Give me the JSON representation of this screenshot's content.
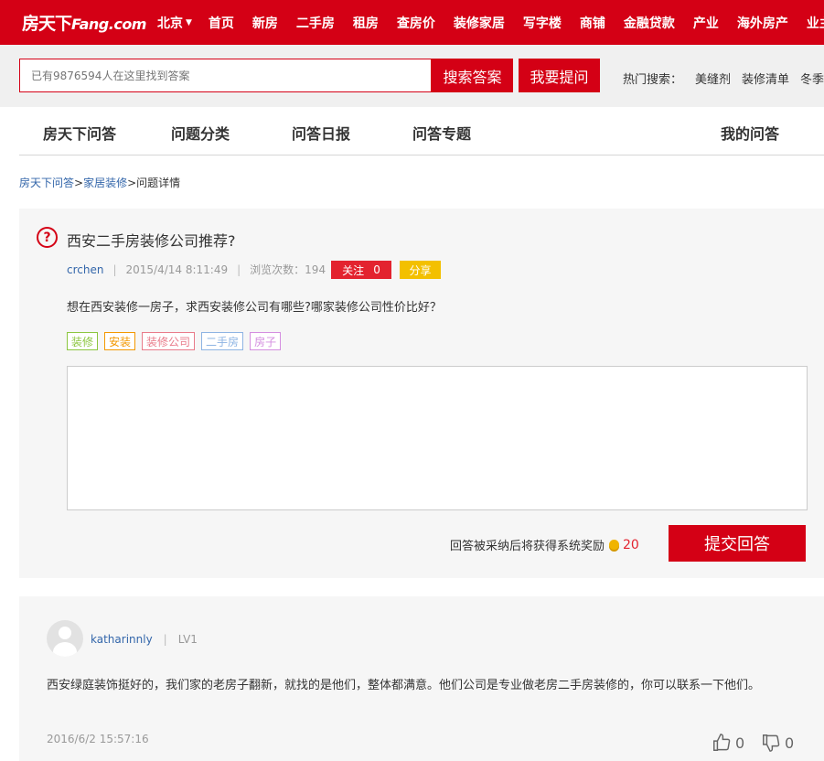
{
  "topnav": {
    "logo_cn": "房天下",
    "logo_en": "Fang.com",
    "city": "北京",
    "links": [
      "首页",
      "新房",
      "二手房",
      "租房",
      "查房价",
      "装修家居",
      "写字楼",
      "商铺",
      "金融贷款",
      "产业",
      "海外房产",
      "业主论"
    ]
  },
  "search": {
    "placeholder": "已有9876594人在这里找到答案",
    "search_button": "搜索答案",
    "ask_button": "我要提问",
    "hot_label": "热门搜索：",
    "hot_terms": [
      "美缝剂",
      "装修清单",
      "冬季"
    ]
  },
  "subnav": {
    "items": [
      "房天下问答",
      "问题分类",
      "问答日报",
      "问答专题"
    ],
    "my_answers": "我的问答"
  },
  "breadcrumb": {
    "items": [
      "房天下问答",
      "家居装修",
      "问题详情"
    ],
    "sep": ">"
  },
  "question": {
    "title": "西安二手房装修公司推荐?",
    "user": "crchen",
    "datetime": "2015/4/14 8:11:49",
    "views_label": "浏览次数：194",
    "follow_label": "关注",
    "follow_count": "0",
    "share_label": "分享",
    "body": "想在西安装修一房子，求西安装修公司有哪些?哪家装修公司性价比好？",
    "tags": [
      {
        "label": "装修",
        "color": "#8cc63f"
      },
      {
        "label": "安装",
        "color": "#f39800"
      },
      {
        "label": "装修公司",
        "color": "#e97b8a"
      },
      {
        "label": "二手房",
        "color": "#8eb4e3"
      },
      {
        "label": "房子",
        "color": "#d48ee0"
      }
    ],
    "reward_text": "回答被采纳后将获得系统奖励",
    "reward_points": "20",
    "submit_button": "提交回答"
  },
  "answer": {
    "user": "katharinnly",
    "level": "LV1",
    "body": "西安绿庭装饰挺好的，我们家的老房子翻新，就找的是他们，整体都满意。他们公司是专业做老房二手房装修的，你可以联系一下他们。",
    "datetime": "2016/6/2 15:57:16",
    "likes": "0",
    "dislikes": "0"
  },
  "colors": {
    "brand_red": "#d40015",
    "link_blue": "#3366aa"
  }
}
